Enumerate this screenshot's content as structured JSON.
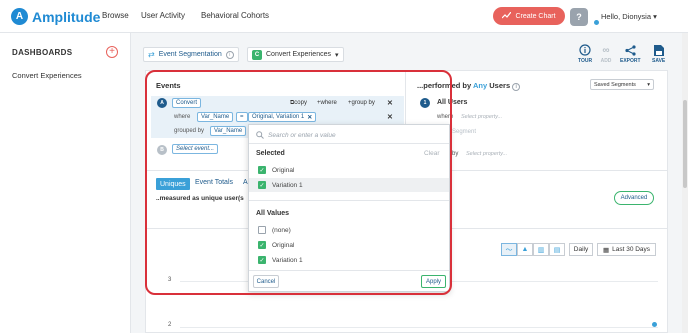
{
  "app": {
    "logo_letter": "A",
    "logo_text": "Amplitude"
  },
  "nav": {
    "browse": "Browse",
    "user_activity": "User Activity",
    "behavioral_cohorts": "Behavioral Cohorts"
  },
  "header": {
    "create_chart": "Create Chart",
    "greeting": "Hello, Dionysia",
    "help": "?"
  },
  "sidebar": {
    "title": "DASHBOARDS",
    "add": "+",
    "items": [
      {
        "label": "Convert Experiences"
      }
    ]
  },
  "toolbar": {
    "chart_type": "Event Segmentation",
    "project_badge": "C",
    "project": "Convert Experiences",
    "tools": [
      {
        "label": "TOUR"
      },
      {
        "label": "ADD"
      },
      {
        "label": "EXPORT"
      },
      {
        "label": "SAVE"
      }
    ]
  },
  "events": {
    "title": "Events",
    "event_a": {
      "badge": "A",
      "name": "Convert",
      "copy": "copy",
      "where": "where",
      "group_by": "group by"
    },
    "where_label": "where",
    "where_property": "Var_Name",
    "operator": "=",
    "where_values": "Original, Variation 1",
    "grouped_by_label": "grouped by",
    "group_property": "Var_Name",
    "event_b": {
      "badge": "B",
      "placeholder": "Select event..."
    }
  },
  "users": {
    "prefix": "...performed by",
    "any": "Any",
    "suffix": "Users",
    "saved_segments": "Saved Segments",
    "segment_badge": "1",
    "segment_name": "All Users",
    "where_label": "where",
    "where_placeholder": "Select property...",
    "segment_link": "Segment",
    "by_label": "by",
    "by_placeholder": "Select property..."
  },
  "measure": {
    "tab_uniques": "Uniques",
    "tab_event_totals": "Event Totals",
    "tab_next": "A",
    "measured_as": "..measured as unique user(s",
    "advanced": "Advanced"
  },
  "chart": {
    "interval": "Daily",
    "range": "Last 30 Days",
    "y_ticks": [
      "3",
      "2"
    ]
  },
  "dropdown": {
    "search_placeholder": "Search or enter a value",
    "selected_header": "Selected",
    "clear": "Clear",
    "selected": [
      {
        "label": "Original",
        "checked": true
      },
      {
        "label": "Variation 1",
        "checked": true
      }
    ],
    "all_header": "All Values",
    "all_values": [
      {
        "label": "(none)",
        "checked": false
      },
      {
        "label": "Original",
        "checked": true
      },
      {
        "label": "Variation 1",
        "checked": true
      }
    ],
    "cancel": "Cancel",
    "apply": "Apply"
  },
  "colors": {
    "brand": "#1f8ad3",
    "accent_red": "#e8625c",
    "check_green": "#3bb46e",
    "highlight_frame": "#d9303a"
  }
}
